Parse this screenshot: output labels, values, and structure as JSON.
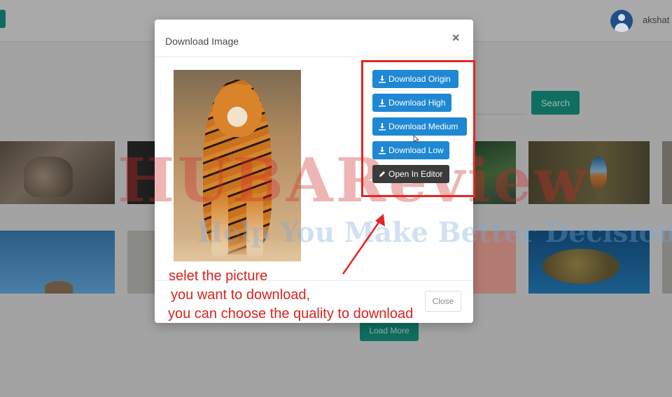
{
  "header": {
    "username": "akshat"
  },
  "background": {
    "search_label": "Search",
    "load_more_label": "Load More"
  },
  "watermark": {
    "main": "HUBAReview",
    "sub": "Help You Make Better Decisions"
  },
  "modal": {
    "title": "Download Image",
    "close_x": "×",
    "close_label": "Close",
    "buttons": [
      {
        "label": "Download Origin",
        "icon": "download-icon"
      },
      {
        "label": "Download High",
        "icon": "download-icon"
      },
      {
        "label": "Download Medium",
        "icon": "download-icon"
      },
      {
        "label": "Download Low",
        "icon": "download-icon"
      },
      {
        "label": "Open In Editor",
        "icon": "pencil-icon"
      }
    ]
  },
  "annotation": {
    "line1": "selet the picture",
    "line2": "you want to download,",
    "line3": "you can choose the quality to download"
  },
  "colors": {
    "primary_button": "#1e88d4",
    "editor_button": "#3b3b3b",
    "annotation_red": "#d8231e",
    "teal": "#0f6e60"
  }
}
